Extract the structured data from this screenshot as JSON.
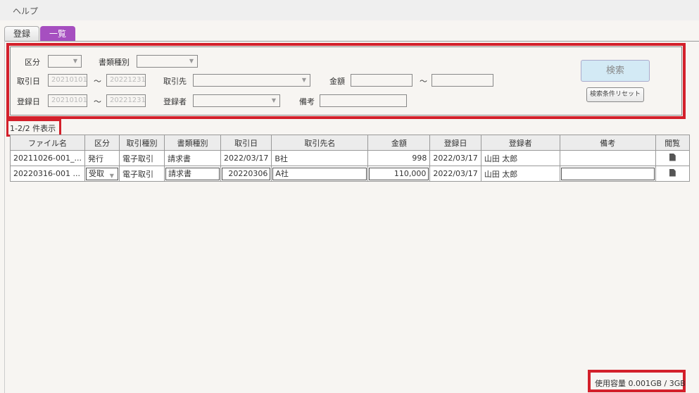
{
  "menu": {
    "help": "ヘルプ"
  },
  "tabs": [
    {
      "label": "登録"
    },
    {
      "label": "一覧"
    }
  ],
  "search": {
    "kubun_label": "区分",
    "shorui_label": "書類種別",
    "torihikibi_label": "取引日",
    "torihikibi_from": "20210101",
    "torihikibi_to": "20221231",
    "torihikisaki_label": "取引先",
    "kingaku_label": "金額",
    "tourokubi_label": "登録日",
    "tourokubi_from": "20210101",
    "tourokubi_to": "20221231",
    "tourokusha_label": "登録者",
    "bikou_label": "備考",
    "tilde": "～",
    "search_button": "検索",
    "reset_button": "検索条件リセット"
  },
  "result_count": "1-2/2 件表示",
  "table": {
    "headers": [
      "ファイル名",
      "区分",
      "取引種別",
      "書類種別",
      "取引日",
      "取引先名",
      "金額",
      "登録日",
      "登録者",
      "備考",
      "閲覧"
    ],
    "rows": [
      [
        "20211026-001_...",
        "発行",
        "電子取引",
        "請求書",
        "2022/03/17",
        "B社",
        "998",
        "2022/03/17",
        "山田 太郎",
        ""
      ],
      [
        "20220316-001 ...",
        "受取",
        "電子取引",
        "請求書",
        "20220306",
        "A社",
        "110,000",
        "2022/03/17",
        "山田 太郎",
        ""
      ]
    ]
  },
  "usage": "使用容量 0.001GB / 3GB"
}
